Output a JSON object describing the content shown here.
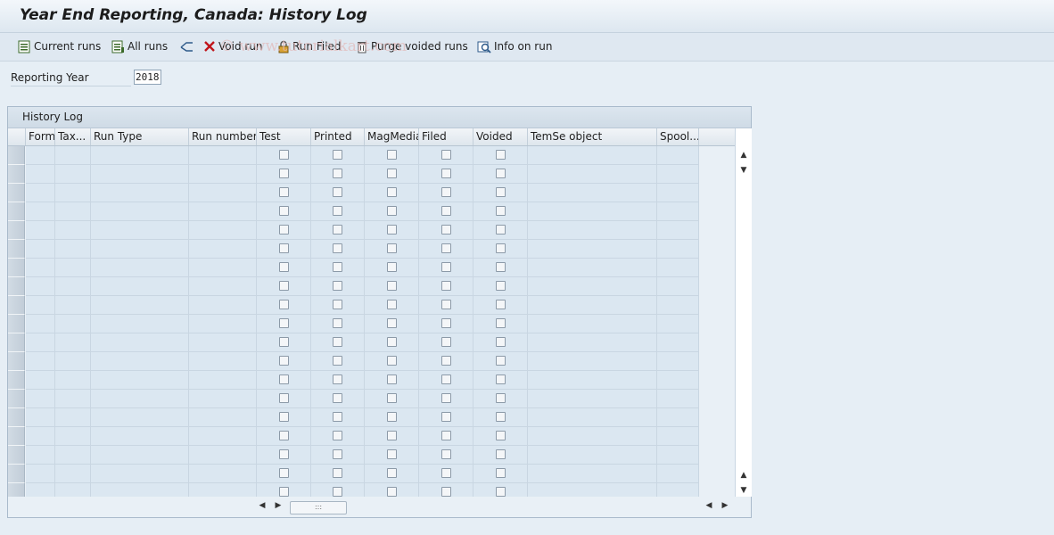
{
  "window": {
    "title": "Year End Reporting, Canada: History Log"
  },
  "toolbar": {
    "items": [
      {
        "label": "Current runs",
        "icon": "list-icon"
      },
      {
        "label": "All runs",
        "icon": "list-all-icon"
      },
      {
        "label": "",
        "icon": "swap-icon"
      },
      {
        "label": "Void run",
        "icon": "x-icon"
      },
      {
        "label": "Run Filed",
        "icon": "lock-icon"
      },
      {
        "label": "Purge voided runs",
        "icon": "trash-icon"
      },
      {
        "label": "Info on run",
        "icon": "info-search-icon"
      }
    ]
  },
  "watermark": "© www.tutorialkart.com",
  "filters": {
    "reporting_year_label": "Reporting Year",
    "reporting_year_value": "2018"
  },
  "table": {
    "title": "History Log",
    "columns": [
      "Form",
      "Tax...",
      "Run Type",
      "Run number",
      "Test",
      "Printed",
      "MagMedia",
      "Filed",
      "Voided",
      "TemSe object",
      "Spool..."
    ],
    "checkbox_columns": [
      "Test",
      "Printed",
      "MagMedia",
      "Filed",
      "Voided"
    ],
    "rows": [
      {
        "Test": false,
        "Printed": false,
        "MagMedia": false,
        "Filed": false,
        "Voided": false
      },
      {
        "Test": false,
        "Printed": false,
        "MagMedia": false,
        "Filed": false,
        "Voided": false
      },
      {
        "Test": false,
        "Printed": false,
        "MagMedia": false,
        "Filed": false,
        "Voided": false
      },
      {
        "Test": false,
        "Printed": false,
        "MagMedia": false,
        "Filed": false,
        "Voided": false
      },
      {
        "Test": false,
        "Printed": false,
        "MagMedia": false,
        "Filed": false,
        "Voided": false
      },
      {
        "Test": false,
        "Printed": false,
        "MagMedia": false,
        "Filed": false,
        "Voided": false
      },
      {
        "Test": false,
        "Printed": false,
        "MagMedia": false,
        "Filed": false,
        "Voided": false
      },
      {
        "Test": false,
        "Printed": false,
        "MagMedia": false,
        "Filed": false,
        "Voided": false
      },
      {
        "Test": false,
        "Printed": false,
        "MagMedia": false,
        "Filed": false,
        "Voided": false
      },
      {
        "Test": false,
        "Printed": false,
        "MagMedia": false,
        "Filed": false,
        "Voided": false
      },
      {
        "Test": false,
        "Printed": false,
        "MagMedia": false,
        "Filed": false,
        "Voided": false
      },
      {
        "Test": false,
        "Printed": false,
        "MagMedia": false,
        "Filed": false,
        "Voided": false
      },
      {
        "Test": false,
        "Printed": false,
        "MagMedia": false,
        "Filed": false,
        "Voided": false
      },
      {
        "Test": false,
        "Printed": false,
        "MagMedia": false,
        "Filed": false,
        "Voided": false
      },
      {
        "Test": false,
        "Printed": false,
        "MagMedia": false,
        "Filed": false,
        "Voided": false
      },
      {
        "Test": false,
        "Printed": false,
        "MagMedia": false,
        "Filed": false,
        "Voided": false
      },
      {
        "Test": false,
        "Printed": false,
        "MagMedia": false,
        "Filed": false,
        "Voided": false
      },
      {
        "Test": false,
        "Printed": false,
        "MagMedia": false,
        "Filed": false,
        "Voided": false
      },
      {
        "Test": false,
        "Printed": false,
        "MagMedia": false,
        "Filed": false,
        "Voided": false
      }
    ]
  },
  "colors": {
    "background": "#e6eef5",
    "cell": "#dbe7f1",
    "header": "#dee6ed"
  }
}
